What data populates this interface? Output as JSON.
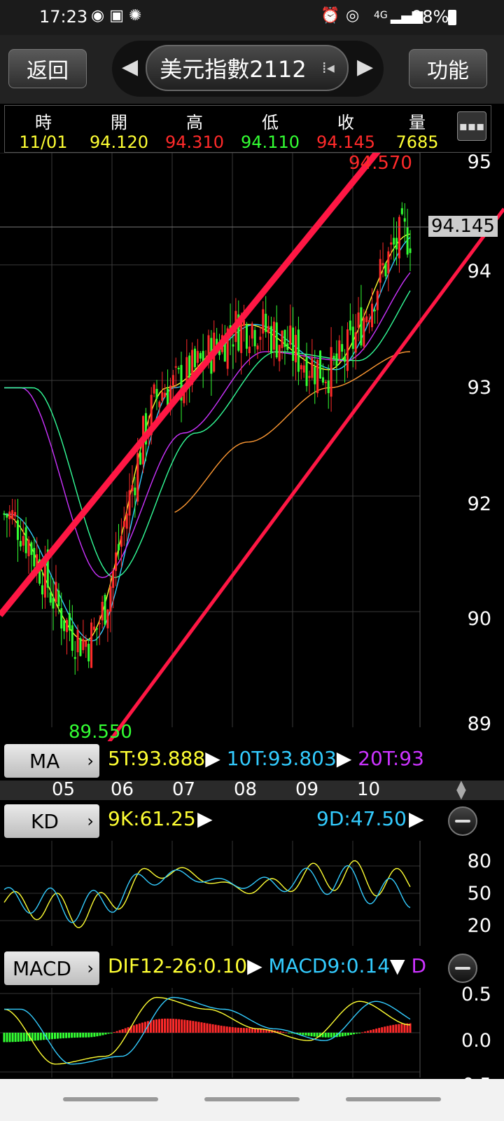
{
  "status_bar": {
    "time": "17:23",
    "network": "4G",
    "battery": "98%"
  },
  "top_nav": {
    "back_label": "返回",
    "title": "美元指數2112",
    "function_label": "功能"
  },
  "quote": {
    "headers": [
      "時",
      "開",
      "高",
      "低",
      "收",
      "量"
    ],
    "values": [
      "11/01",
      "94.120",
      "94.310",
      "94.110",
      "94.145",
      "7685"
    ],
    "colors": [
      "#ffff33",
      "#ffff33",
      "#ff2a2a",
      "#33ff33",
      "#ff2a2a",
      "#ffff33"
    ]
  },
  "price_chart": {
    "y_labels": [
      "95",
      "94",
      "93",
      "92",
      "90",
      "89"
    ],
    "current_price": "94.145",
    "high_label": "94.570",
    "low_label": "89.550",
    "trend_color": "#ff1744",
    "up_color": "#ff2a2a",
    "down_color": "#33ff33"
  },
  "ma_bar": {
    "label": "MA",
    "ma5": "5T:93.888",
    "ma10": "10T:93.803",
    "ma20": "20T:93"
  },
  "x_axis": {
    "months": [
      "05",
      "06",
      "07",
      "08",
      "09",
      "10"
    ]
  },
  "kd_bar": {
    "label": "KD",
    "k": "9K:61.25",
    "d": "9D:47.50"
  },
  "kd_axis": [
    "80",
    "50",
    "20"
  ],
  "macd_bar": {
    "label": "MACD",
    "dif": "DIF12-26:0.10",
    "macd": "MACD9:0.14",
    "osc": "D"
  },
  "macd_axis": [
    "0.5",
    "0.0",
    "-0.5"
  ],
  "chart_data": [
    {
      "type": "line",
      "title": "",
      "x": [
        "05",
        "06",
        "07",
        "08",
        "09",
        "10"
      ],
      "series": [
        {
          "name": "",
          "values": [
            91.2,
            89.8,
            92.6,
            93.3,
            92.8,
            94.3
          ]
        },
        {
          "name": "",
          "values": [
            92.6,
            90.5,
            92.1,
            93.0,
            92.9,
            94.0
          ]
        }
      ],
      "ylim": [
        89,
        95.2
      ]
    },
    {
      "type": "line",
      "title": "",
      "x": [
        "05",
        "06",
        "07",
        "08",
        "09",
        "10"
      ],
      "series": [
        {
          "name": "9K",
          "values": [
            40,
            30,
            75,
            55,
            70,
            61.25
          ]
        },
        {
          "name": "9D",
          "values": [
            45,
            35,
            70,
            60,
            65,
            47.5
          ]
        }
      ],
      "ylim": [
        0,
        100
      ]
    },
    {
      "type": "bar",
      "title": "",
      "categories": [
        "05",
        "06",
        "07",
        "08",
        "09",
        "10"
      ],
      "values": [
        -0.2,
        -0.1,
        0.3,
        0.1,
        -0.1,
        0.2
      ],
      "ylim": [
        -0.5,
        0.5
      ]
    }
  ]
}
